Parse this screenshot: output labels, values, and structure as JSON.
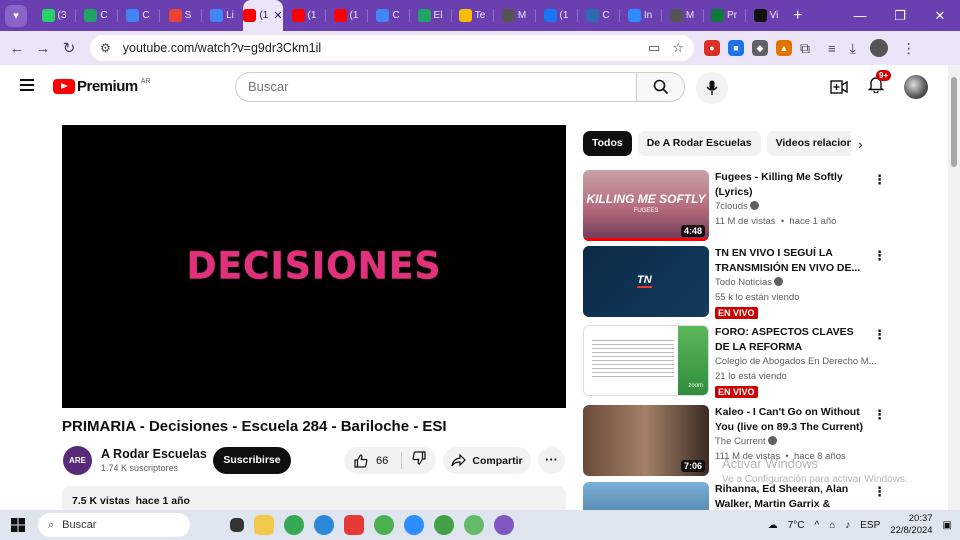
{
  "browser": {
    "tabs": [
      {
        "label": "(3",
        "color": "#25d366"
      },
      {
        "label": "C",
        "color": "#1fa463"
      },
      {
        "label": "C",
        "color": "#4285f4"
      },
      {
        "label": "S",
        "color": "#ea4335"
      },
      {
        "label": "Li",
        "color": "#4285f4"
      },
      {
        "label": "(1",
        "color": "#ff0000",
        "active": true
      },
      {
        "label": "(1",
        "color": "#ff0000"
      },
      {
        "label": "(1",
        "color": "#ff0000"
      },
      {
        "label": "C",
        "color": "#4285f4"
      },
      {
        "label": "El",
        "color": "#1fa463"
      },
      {
        "label": "Te",
        "color": "#fbbc04"
      },
      {
        "label": "M",
        "color": "#555555"
      },
      {
        "label": "(1",
        "color": "#1877f2"
      },
      {
        "label": "C",
        "color": "#2b6cb0"
      },
      {
        "label": "In",
        "color": "#2d8cff"
      },
      {
        "label": "M",
        "color": "#555555"
      },
      {
        "label": "Pr",
        "color": "#0f7b3a"
      },
      {
        "label": "Vi",
        "color": "#111111"
      }
    ],
    "url": "youtube.com/watch?v=g9dr3Ckm1il"
  },
  "yt": {
    "logo_text": "Premium",
    "country": "AR",
    "search_placeholder": "Buscar",
    "notif_count": "9+"
  },
  "video": {
    "overlay_text": "DECISIONES",
    "title": "PRIMARIA - Decisiones - Escuela 284 - Bariloche - ESI",
    "channel": "A Rodar Escuelas",
    "channel_initials": "ARE",
    "subscribers": "1.74 K suscriptores",
    "subscribe_label": "Suscribirse",
    "likes": "66",
    "share_label": "Compartir",
    "description_stats": "7.5 K vistas  hace 1 año"
  },
  "chips": [
    "Todos",
    "De A Rodar Escuelas",
    "Videos relacionados"
  ],
  "recs": [
    {
      "title": "Fugees - Killing Me Softly (Lyrics)",
      "channel": "7clouds",
      "verified": true,
      "meta": "11 M de vistas  •  hace 1 año",
      "duration": "4:48",
      "thumb_text": "KILLING ME SOFTLY",
      "thumb_sub": "FUGEES"
    },
    {
      "title": "TN EN VIVO I SEGUÍ LA TRANSMISIÓN EN VIVO DE...",
      "channel": "Todo Noticias",
      "verified": true,
      "meta": "55 k lo están viendo",
      "live": "EN VIVO",
      "thumb_text": "TN"
    },
    {
      "title": "FORO: ASPECTOS CLAVES DE LA REFORMA PENSIONAL",
      "channel": "Colegio de Abogados En Derecho M...",
      "verified": false,
      "meta": "21 lo está viendo",
      "live": "EN VIVO",
      "thumb_text": "zoom"
    },
    {
      "title": "Kaleo - I Can't Go on Without You (live on 89.3 The Current)",
      "channel": "The Current",
      "verified": true,
      "meta": "111 M de vistas  •  hace 8 años",
      "duration": "7:06"
    },
    {
      "title": "Rihanna, Ed Sheeran, Alan Walker, Martin Garrix & Kygo,...",
      "channel": "",
      "meta": ""
    }
  ],
  "watermark": {
    "line1": "Activar Windows",
    "line2": "Ve a Configuración para activar Windows."
  },
  "taskbar": {
    "search": "Buscar",
    "weather": "7°C",
    "lang": "ESP",
    "time": "20:37",
    "date": "22/8/2024"
  }
}
